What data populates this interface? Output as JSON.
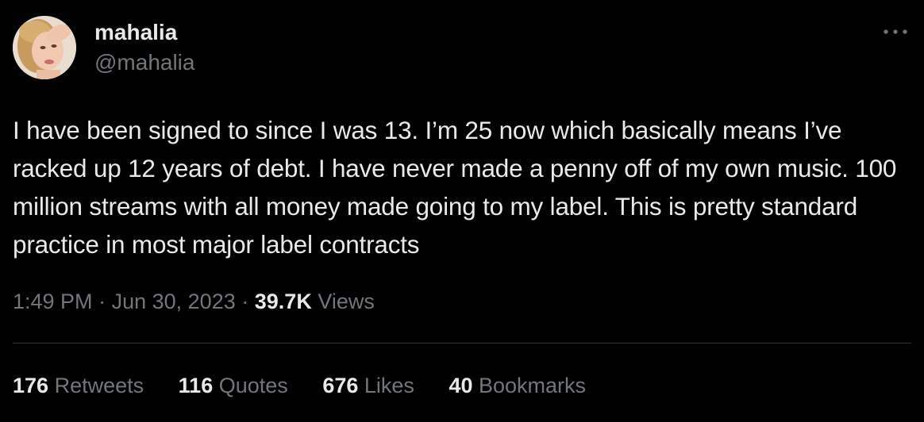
{
  "author": {
    "display_name": "mahalia",
    "handle": "@mahalia"
  },
  "tweet": {
    "text": "I have been signed to since I was 13. I’m 25 now which basically means I’ve racked up 12 years of debt. I have never made a penny off of my own music. 100 million streams with all money made going to my label. This is pretty standard practice in most major label contracts"
  },
  "meta": {
    "time": "1:49 PM",
    "separator": "·",
    "date": "Jun 30, 2023",
    "views_count": "39.7K",
    "views_label": "Views"
  },
  "stats": [
    {
      "count": "176",
      "label": "Retweets"
    },
    {
      "count": "116",
      "label": "Quotes"
    },
    {
      "count": "676",
      "label": "Likes"
    },
    {
      "count": "40",
      "label": "Bookmarks"
    }
  ],
  "icons": {
    "more": "more-horizontal-icon"
  },
  "colors": {
    "background": "#000000",
    "primary_text": "#e7e9ea",
    "secondary_text": "#71767b",
    "divider": "#2f3336"
  }
}
